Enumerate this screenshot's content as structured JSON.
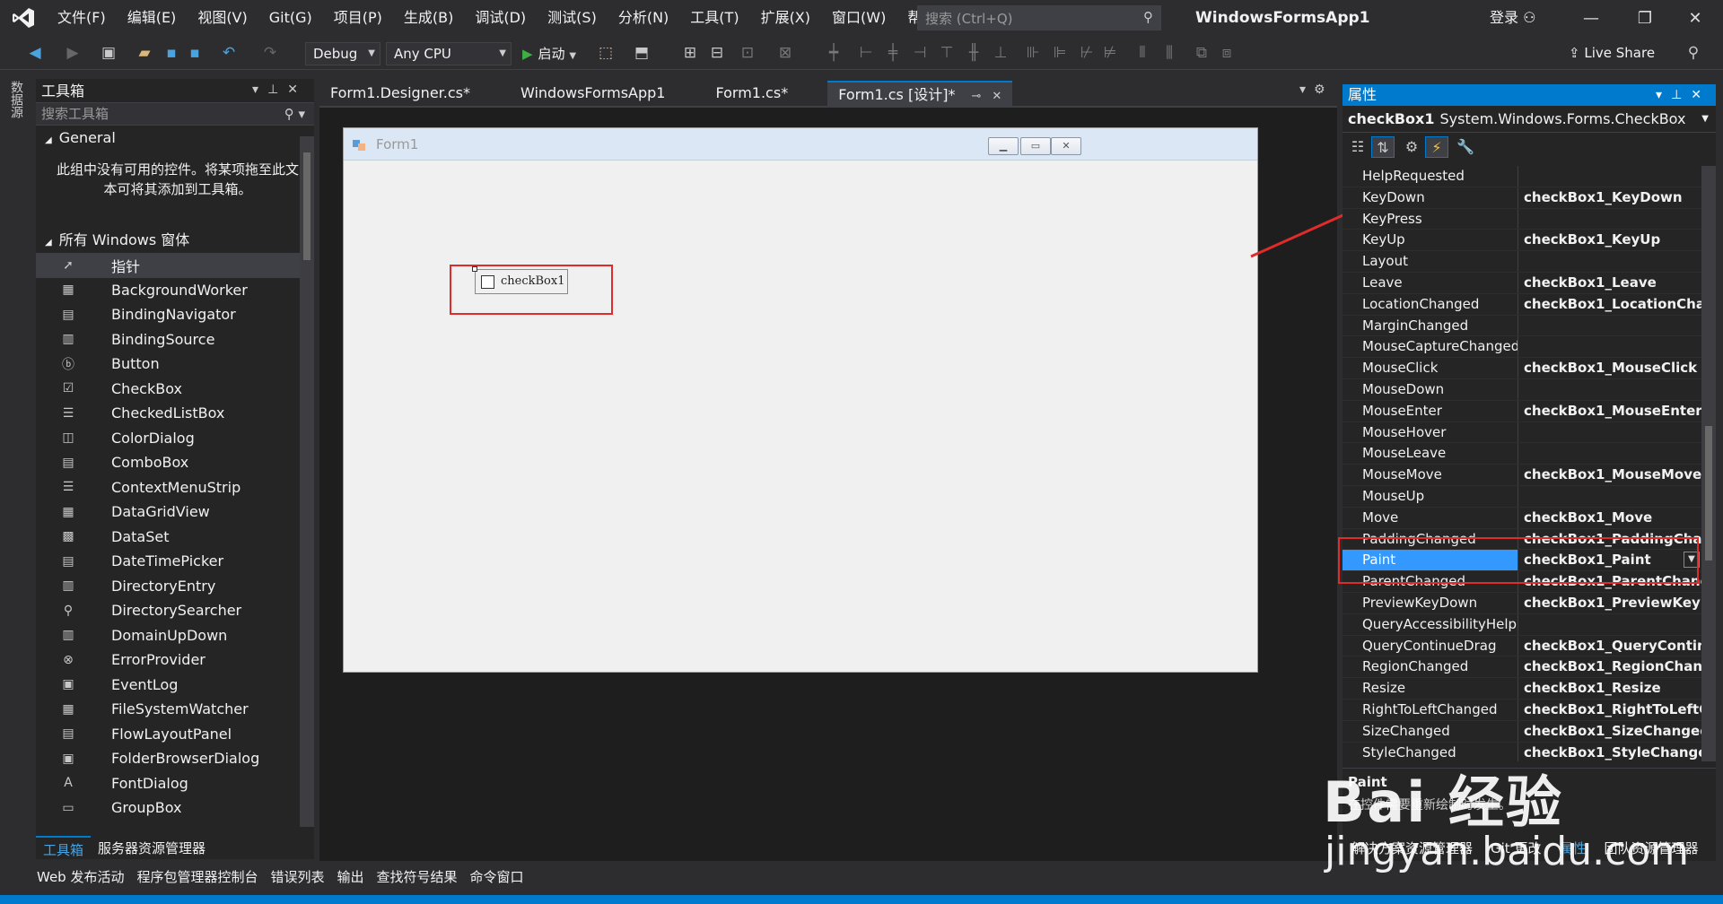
{
  "menu": [
    "文件(F)",
    "编辑(E)",
    "视图(V)",
    "Git(G)",
    "项目(P)",
    "生成(B)",
    "调试(D)",
    "测试(S)",
    "分析(N)",
    "工具(T)",
    "扩展(X)",
    "窗口(W)",
    "帮助(H)"
  ],
  "search": {
    "placeholder": "搜索 (Ctrl+Q)"
  },
  "solution_name": "WindowsFormsApp1",
  "login": "登录",
  "toolbar": {
    "config": "Debug",
    "platform": "Any CPU",
    "start": "启动",
    "live_share": "Live Share"
  },
  "left_strip": {
    "tab": "数据源"
  },
  "toolbox": {
    "title": "工具箱",
    "search_placeholder": "搜索工具箱",
    "group_general": "General",
    "general_empty": "此组中没有可用的控件。将某项拖至此文本可将其添加到工具箱。",
    "group_all": "所有 Windows 窗体",
    "items": [
      "指针",
      "BackgroundWorker",
      "BindingNavigator",
      "BindingSource",
      "Button",
      "CheckBox",
      "CheckedListBox",
      "ColorDialog",
      "ComboBox",
      "ContextMenuStrip",
      "DataGridView",
      "DataSet",
      "DateTimePicker",
      "DirectoryEntry",
      "DirectorySearcher",
      "DomainUpDown",
      "ErrorProvider",
      "EventLog",
      "FileSystemWatcher",
      "FlowLayoutPanel",
      "FolderBrowserDialog",
      "FontDialog",
      "GroupBox"
    ],
    "bottom_tabs": [
      "工具箱",
      "服务器资源管理器"
    ]
  },
  "doc_tabs": [
    "Form1.Designer.cs*",
    "WindowsFormsApp1",
    "Form1.cs*",
    "Form1.cs [设计]*"
  ],
  "form": {
    "title": "Form1",
    "checkbox_label": "checkBox1"
  },
  "properties": {
    "title": "属性",
    "object_name": "checkBox1",
    "object_type": "System.Windows.Forms.CheckBox",
    "rows": [
      {
        "name": "HelpRequested",
        "value": ""
      },
      {
        "name": "KeyDown",
        "value": "checkBox1_KeyDown"
      },
      {
        "name": "KeyPress",
        "value": ""
      },
      {
        "name": "KeyUp",
        "value": "checkBox1_KeyUp"
      },
      {
        "name": "Layout",
        "value": ""
      },
      {
        "name": "Leave",
        "value": "checkBox1_Leave"
      },
      {
        "name": "LocationChanged",
        "value": "checkBox1_LocationChar"
      },
      {
        "name": "MarginChanged",
        "value": ""
      },
      {
        "name": "MouseCaptureChanged",
        "value": ""
      },
      {
        "name": "MouseClick",
        "value": "checkBox1_MouseClick"
      },
      {
        "name": "MouseDown",
        "value": ""
      },
      {
        "name": "MouseEnter",
        "value": "checkBox1_MouseEnter"
      },
      {
        "name": "MouseHover",
        "value": ""
      },
      {
        "name": "MouseLeave",
        "value": ""
      },
      {
        "name": "MouseMove",
        "value": "checkBox1_MouseMove"
      },
      {
        "name": "MouseUp",
        "value": ""
      },
      {
        "name": "Move",
        "value": "checkBox1_Move"
      },
      {
        "name": "PaddingChanged",
        "value": "checkBox1_PaddingChan"
      },
      {
        "name": "Paint",
        "value": "checkBox1_Paint",
        "selected": true
      },
      {
        "name": "ParentChanged",
        "value": "checkBox1_ParentChang"
      },
      {
        "name": "PreviewKeyDown",
        "value": "checkBox1_PreviewKeyD"
      },
      {
        "name": "QueryAccessibilityHelp",
        "value": ""
      },
      {
        "name": "QueryContinueDrag",
        "value": "checkBox1_QueryContinu"
      },
      {
        "name": "RegionChanged",
        "value": "checkBox1_RegionChang"
      },
      {
        "name": "Resize",
        "value": "checkBox1_Resize"
      },
      {
        "name": "RightToLeftChanged",
        "value": "checkBox1_RightToLeftC"
      },
      {
        "name": "SizeChanged",
        "value": "checkBox1_SizeChanged"
      },
      {
        "name": "StyleChanged",
        "value": "checkBox1_StyleChangec"
      }
    ],
    "desc_name": "Paint",
    "desc_text": "在控件需要重新绘制时发生。",
    "bottom_tabs": [
      "解决方案资源管理器",
      "Git 更改",
      "属性",
      "团队资源管理器"
    ]
  },
  "bottom_tabs": [
    "Web 发布活动",
    "程序包管理器控制台",
    "错误列表",
    "输出",
    "查找符号结果",
    "命令窗口"
  ],
  "watermark": {
    "brand": "Bai 经验",
    "url": "jingyan.baidu.com"
  },
  "colors": {
    "accent": "#007acc",
    "highlight": "#e02b2b",
    "selection": "#3399ff"
  }
}
